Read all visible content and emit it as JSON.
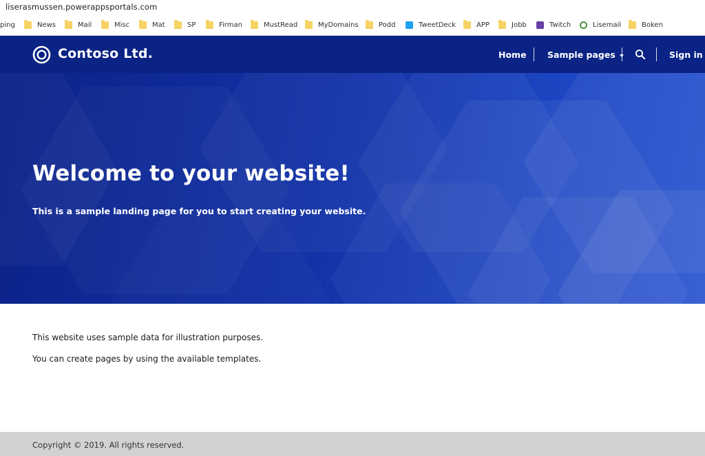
{
  "browser": {
    "url": "liserasmussen.powerappsportals.com",
    "bookmarks": [
      {
        "label": "ping",
        "icon": "none"
      },
      {
        "label": "News",
        "icon": "folder-icon"
      },
      {
        "label": "Mail",
        "icon": "folder-icon"
      },
      {
        "label": "Misc",
        "icon": "folder-icon"
      },
      {
        "label": "Mat",
        "icon": "folder-icon"
      },
      {
        "label": "SP",
        "icon": "folder-icon"
      },
      {
        "label": "Firman",
        "icon": "folder-icon"
      },
      {
        "label": "MustRead",
        "icon": "folder-icon"
      },
      {
        "label": "MyDomains",
        "icon": "folder-icon"
      },
      {
        "label": "Podd",
        "icon": "folder-icon"
      },
      {
        "label": "TweetDeck",
        "icon": "twitter-icon"
      },
      {
        "label": "APP",
        "icon": "folder-icon"
      },
      {
        "label": "Jobb",
        "icon": "folder-icon"
      },
      {
        "label": "Twitch",
        "icon": "twitch-icon"
      },
      {
        "label": "Lisemail",
        "icon": "lisemail-icon"
      },
      {
        "label": "Boken",
        "icon": "folder-icon"
      }
    ]
  },
  "header": {
    "brand": "Contoso Ltd.",
    "logo_icon": "contoso-ring-logo-icon",
    "nav": {
      "home": "Home",
      "sample_pages": "Sample pages",
      "search_icon": "search-icon",
      "sign_in": "Sign in"
    }
  },
  "hero": {
    "title": "Welcome to your website!",
    "subtitle": "This is a sample landing page for you to start creating your website."
  },
  "content": {
    "paragraphs": [
      "This website uses sample data for illustration purposes.",
      "You can create pages by using the available templates."
    ]
  },
  "footer": {
    "copyright": "Copyright © 2019. All rights reserved."
  },
  "colors": {
    "header_bg": "#0a2384",
    "hero_start": "#0b2288",
    "hero_end": "#2a55d0",
    "footer_bg": "#d2d2d0",
    "folder": "#f6d365",
    "twitter": "#1da1f2",
    "twitch": "#6441a5"
  }
}
